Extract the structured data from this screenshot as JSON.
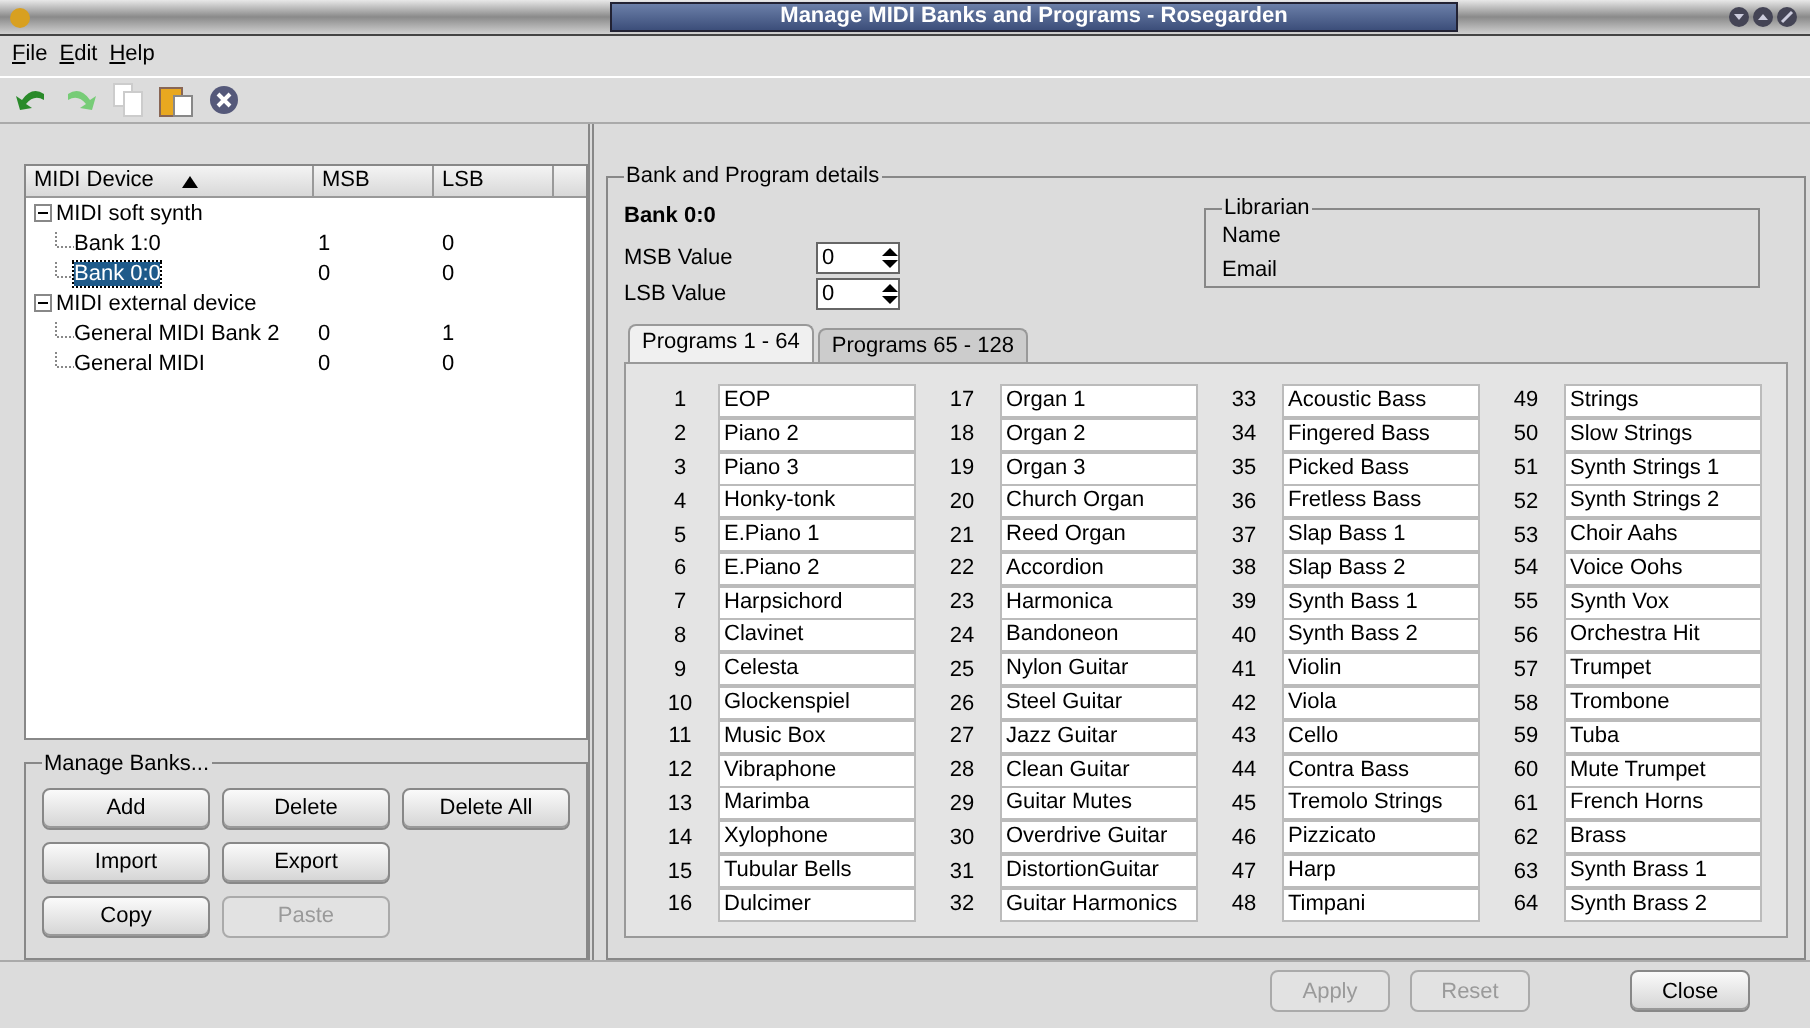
{
  "window": {
    "title": "Manage MIDI Banks and Programs - Rosegarden"
  },
  "menu": [
    "File",
    "Edit",
    "Help"
  ],
  "toolbar": [
    {
      "kind": "undo",
      "disabled": false
    },
    {
      "kind": "redo",
      "disabled": false
    },
    {
      "kind": "copy",
      "disabled": true
    },
    {
      "kind": "paste",
      "disabled": false
    },
    {
      "kind": "delete",
      "disabled": false
    }
  ],
  "tree": {
    "columns": [
      "MIDI Device",
      "MSB",
      "LSB"
    ],
    "items": [
      {
        "name": "MIDI soft synth",
        "expanded": true,
        "children": [
          {
            "name": "Bank 1:0",
            "msb": "1",
            "lsb": "0",
            "selected": false
          },
          {
            "name": "Bank 0:0",
            "msb": "0",
            "lsb": "0",
            "selected": true
          }
        ]
      },
      {
        "name": "MIDI external device",
        "expanded": true,
        "children": [
          {
            "name": "General MIDI Bank 2",
            "msb": "0",
            "lsb": "1",
            "selected": false
          },
          {
            "name": "General MIDI",
            "msb": "0",
            "lsb": "0",
            "selected": false
          }
        ]
      }
    ]
  },
  "manage_banks": {
    "title": "Manage Banks...",
    "rows": [
      [
        {
          "label": "Add",
          "disabled": false
        },
        {
          "label": "Delete",
          "disabled": false
        },
        {
          "label": "Delete All",
          "disabled": false
        }
      ],
      [
        {
          "label": "Import",
          "disabled": false
        },
        {
          "label": "Export",
          "disabled": false
        }
      ],
      [
        {
          "label": "Copy",
          "disabled": false
        },
        {
          "label": "Paste",
          "disabled": true
        }
      ]
    ]
  },
  "details": {
    "title": "Bank and Program details",
    "bank": "Bank 0:0",
    "fields": [
      {
        "label": "MSB Value",
        "value": "0"
      },
      {
        "label": "LSB Value",
        "value": "0"
      }
    ],
    "librarian": {
      "title": "Librarian",
      "rows": [
        "Name",
        "Email"
      ]
    },
    "tabs": [
      {
        "label": "Programs 1 - 64",
        "selected": true
      },
      {
        "label": "Programs 65 - 128",
        "selected": false
      }
    ],
    "programs": [
      {
        "number": "1",
        "name": "EOP"
      },
      {
        "number": "2",
        "name": "Piano 2"
      },
      {
        "number": "3",
        "name": "Piano 3"
      },
      {
        "number": "4",
        "name": "Honky-tonk"
      },
      {
        "number": "5",
        "name": "E.Piano 1"
      },
      {
        "number": "6",
        "name": "E.Piano 2"
      },
      {
        "number": "7",
        "name": "Harpsichord"
      },
      {
        "number": "8",
        "name": "Clavinet"
      },
      {
        "number": "9",
        "name": "Celesta"
      },
      {
        "number": "10",
        "name": "Glockenspiel"
      },
      {
        "number": "11",
        "name": "Music Box"
      },
      {
        "number": "12",
        "name": "Vibraphone"
      },
      {
        "number": "13",
        "name": "Marimba"
      },
      {
        "number": "14",
        "name": "Xylophone"
      },
      {
        "number": "15",
        "name": "Tubular Bells"
      },
      {
        "number": "16",
        "name": "Dulcimer"
      },
      {
        "number": "17",
        "name": "Organ 1"
      },
      {
        "number": "18",
        "name": "Organ 2"
      },
      {
        "number": "19",
        "name": "Organ 3"
      },
      {
        "number": "20",
        "name": "Church Organ"
      },
      {
        "number": "21",
        "name": "Reed Organ"
      },
      {
        "number": "22",
        "name": "Accordion"
      },
      {
        "number": "23",
        "name": "Harmonica"
      },
      {
        "number": "24",
        "name": "Bandoneon"
      },
      {
        "number": "25",
        "name": "Nylon Guitar"
      },
      {
        "number": "26",
        "name": "Steel Guitar"
      },
      {
        "number": "27",
        "name": "Jazz Guitar"
      },
      {
        "number": "28",
        "name": "Clean Guitar"
      },
      {
        "number": "29",
        "name": "Guitar Mutes"
      },
      {
        "number": "30",
        "name": "Overdrive Guitar"
      },
      {
        "number": "31",
        "name": "DistortionGuitar"
      },
      {
        "number": "32",
        "name": "Guitar Harmonics"
      },
      {
        "number": "33",
        "name": "Acoustic Bass"
      },
      {
        "number": "34",
        "name": "Fingered Bass"
      },
      {
        "number": "35",
        "name": "Picked Bass"
      },
      {
        "number": "36",
        "name": "Fretless Bass"
      },
      {
        "number": "37",
        "name": "Slap Bass 1"
      },
      {
        "number": "38",
        "name": "Slap Bass 2"
      },
      {
        "number": "39",
        "name": "Synth Bass 1"
      },
      {
        "number": "40",
        "name": "Synth Bass 2"
      },
      {
        "number": "41",
        "name": "Violin"
      },
      {
        "number": "42",
        "name": "Viola"
      },
      {
        "number": "43",
        "name": "Cello"
      },
      {
        "number": "44",
        "name": "Contra Bass"
      },
      {
        "number": "45",
        "name": "Tremolo Strings"
      },
      {
        "number": "46",
        "name": "Pizzicato"
      },
      {
        "number": "47",
        "name": "Harp"
      },
      {
        "number": "48",
        "name": "Timpani"
      },
      {
        "number": "49",
        "name": "Strings"
      },
      {
        "number": "50",
        "name": "Slow Strings"
      },
      {
        "number": "51",
        "name": "Synth Strings 1"
      },
      {
        "number": "52",
        "name": "Synth Strings 2"
      },
      {
        "number": "53",
        "name": "Choir Aahs"
      },
      {
        "number": "54",
        "name": "Voice Oohs"
      },
      {
        "number": "55",
        "name": "Synth Vox"
      },
      {
        "number": "56",
        "name": "Orchestra Hit"
      },
      {
        "number": "57",
        "name": "Trumpet"
      },
      {
        "number": "58",
        "name": "Trombone"
      },
      {
        "number": "59",
        "name": "Tuba"
      },
      {
        "number": "60",
        "name": "Mute Trumpet"
      },
      {
        "number": "61",
        "name": "French Horns"
      },
      {
        "number": "62",
        "name": "Brass"
      },
      {
        "number": "63",
        "name": "Synth Brass 1"
      },
      {
        "number": "64",
        "name": "Synth Brass 2"
      }
    ]
  },
  "buttons": [
    {
      "label": "Apply",
      "disabled": true
    },
    {
      "label": "Reset",
      "disabled": true
    },
    {
      "label": "Close",
      "disabled": false
    }
  ]
}
